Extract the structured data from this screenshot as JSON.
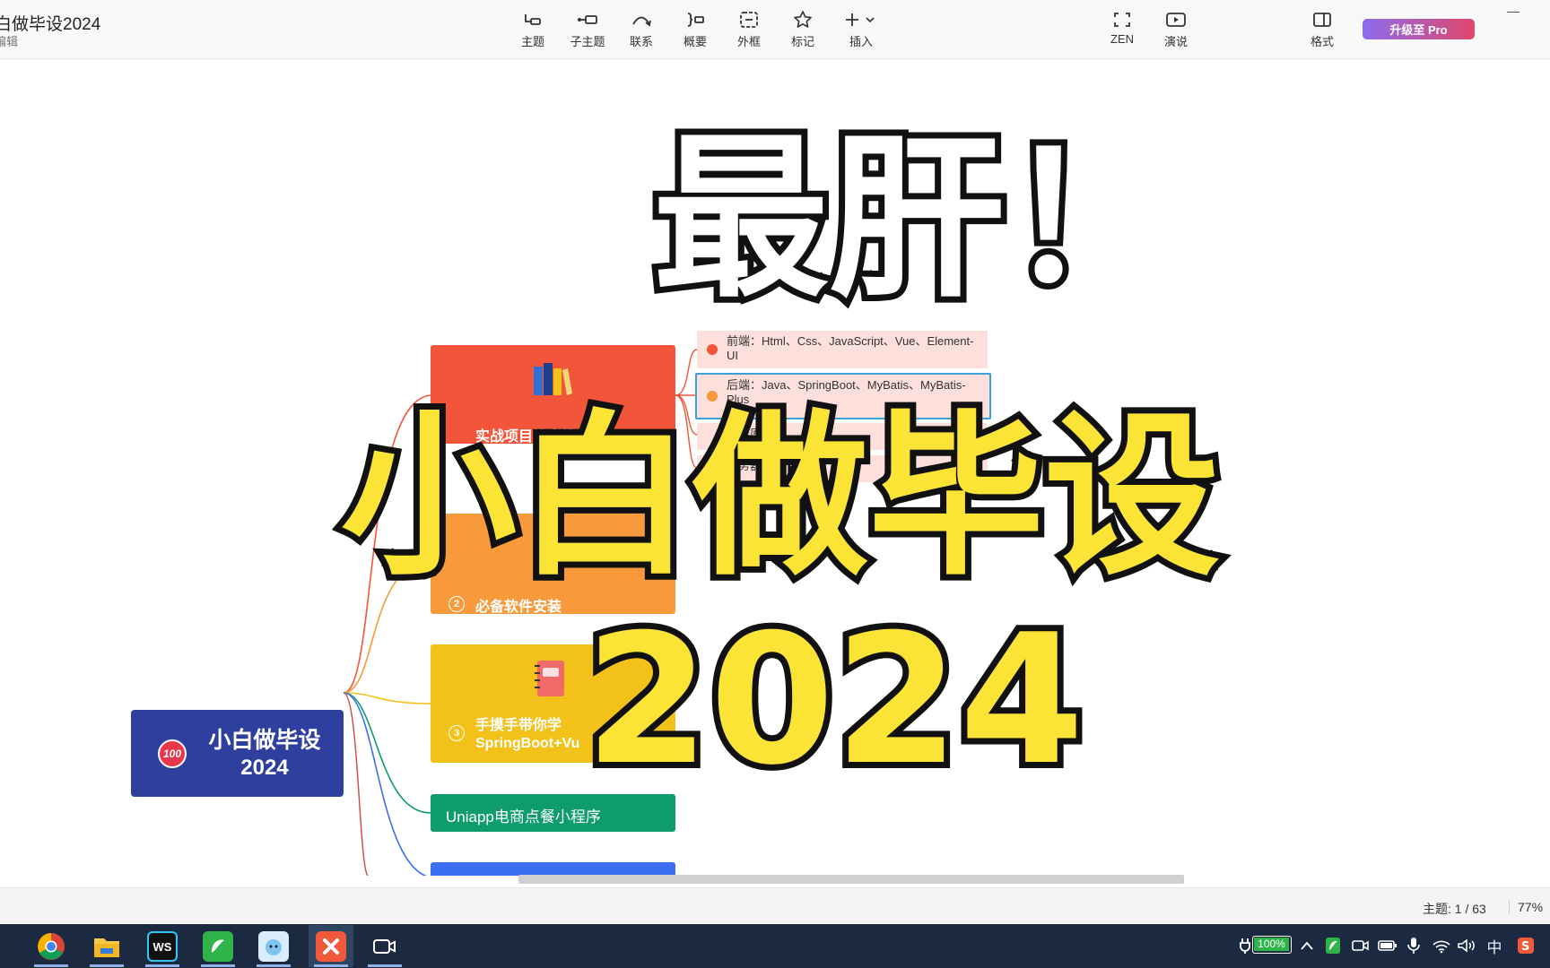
{
  "app": {
    "doc_title": "白做毕设2024",
    "doc_subtitle": "编辑"
  },
  "toolbar": {
    "topic": "主题",
    "subtopic": "子主题",
    "relation": "联系",
    "summary": "概要",
    "boundary": "外框",
    "marker": "标记",
    "insert": "插入",
    "zen": "ZEN",
    "present": "演说",
    "format": "格式",
    "upgrade": "升级至 Pro"
  },
  "mindmap": {
    "root_line1": "小白做毕设",
    "root_line2": "2024",
    "root_badge": "100",
    "branch_tech_stack": "实战项目技术栈",
    "branch_software": "必备软件安装",
    "branch_software_num": "2",
    "branch_springboot_line1": "手摸手带你学",
    "branch_springboot_line2": "SpringBoot+Vu",
    "branch_springboot_num": "3",
    "branch_uniapp": "Uniapp电商点餐小程序",
    "leaf_frontend": "前端：Html、Css、JavaScript、Vue、Element-UI",
    "leaf_backend": "后端：Java、SpringBoot、MyBatis、MyBatis-Plus",
    "leaf_database": "数据库：M",
    "leaf_server": "服务器"
  },
  "overlay": {
    "line1": "最肝！",
    "line2": "小白做毕设",
    "line3": "2024"
  },
  "statusbar": {
    "topics": "主题: 1 / 63",
    "zoom": "77%"
  },
  "taskbar": {
    "battery": "100%",
    "ime": "中",
    "ws_label": "WS"
  },
  "colors": {
    "root": "#2f3f9e",
    "tech_stack": "#f2553a",
    "software": "#f89a3c",
    "springboot": "#f2c21b",
    "uniapp": "#0e9b6d",
    "overlay_yellow": "#fbe436",
    "pro_button": "#8c6cf0"
  }
}
